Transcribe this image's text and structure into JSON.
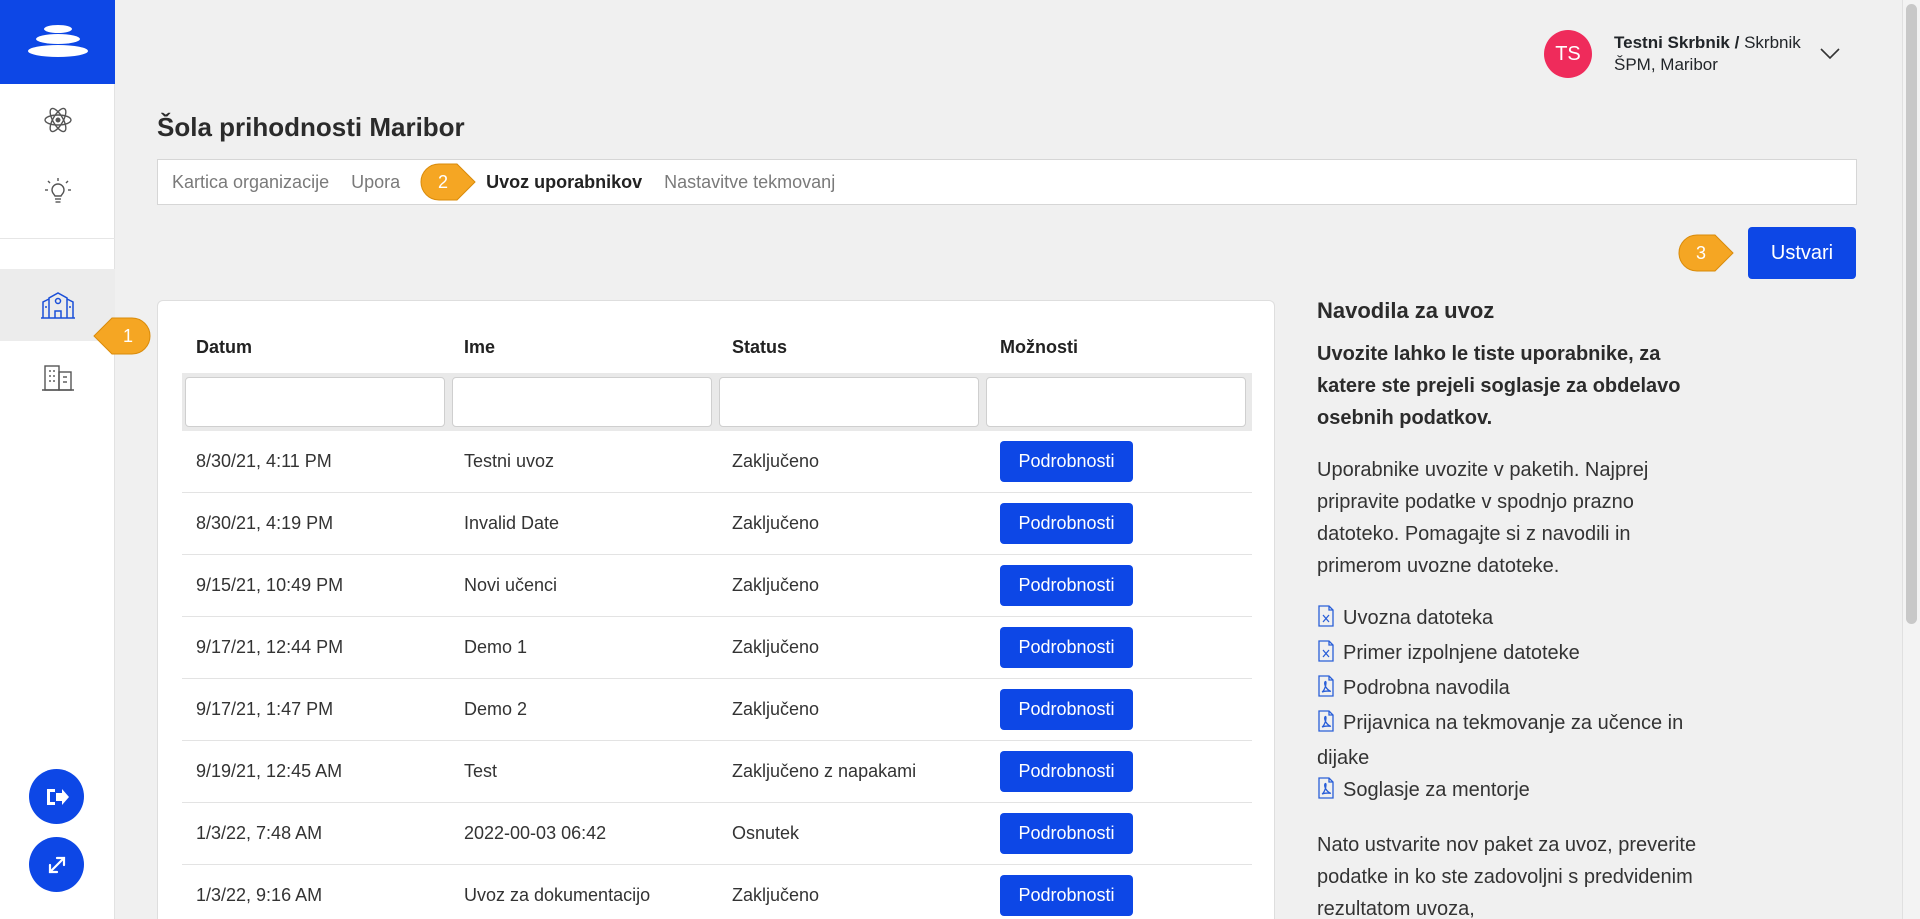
{
  "user": {
    "initials": "TS",
    "name": "Testni Skrbnik",
    "separator": " / ",
    "role": "Skrbnik",
    "org": "ŠPM, Maribor"
  },
  "page": {
    "title": "Šola prihodnosti Maribor"
  },
  "tabs": [
    {
      "label": "Kartica organizacije",
      "active": false
    },
    {
      "label": "Upora",
      "active": false
    },
    {
      "label": "Uvoz uporabnikov",
      "active": true
    },
    {
      "label": "Nastavitve tekmovanj",
      "active": false
    }
  ],
  "callouts": [
    "1",
    "2",
    "3"
  ],
  "actions": {
    "create_label": "Ustvari"
  },
  "table": {
    "headers": [
      "Datum",
      "Ime",
      "Status",
      "Možnosti"
    ],
    "button_label": "Podrobnosti",
    "rows": [
      {
        "date": "8/30/21, 4:11 PM",
        "name": "Testni uvoz",
        "status": "Zaključeno"
      },
      {
        "date": "8/30/21, 4:19 PM",
        "name": "Invalid Date",
        "status": "Zaključeno"
      },
      {
        "date": "9/15/21, 10:49 PM",
        "name": "Novi učenci",
        "status": "Zaključeno"
      },
      {
        "date": "9/17/21, 12:44 PM",
        "name": "Demo 1",
        "status": "Zaključeno"
      },
      {
        "date": "9/17/21, 1:47 PM",
        "name": "Demo 2",
        "status": "Zaključeno"
      },
      {
        "date": "9/19/21, 12:45 AM",
        "name": "Test",
        "status": "Zaključeno z napakami"
      },
      {
        "date": "1/3/22, 7:48 AM",
        "name": "2022-00-03 06:42",
        "status": "Osnutek"
      },
      {
        "date": "1/3/22, 9:16 AM",
        "name": "Uvoz za dokumentacijo",
        "status": "Zaključeno"
      }
    ]
  },
  "instructions": {
    "title": "Navodila za uvoz",
    "lead": "Uvozite lahko le tiste uporabnike, za katere ste prejeli soglasje za obdelavo osebnih podatkov.",
    "para1": "Uporabnike uvozite v paketih. Najprej pripravite podatke v spodnjo prazno datoteko. Pomagajte si z navodili in primerom uvozne datoteke.",
    "files": [
      {
        "label": "Uvozna datoteka",
        "icon": "excel-file-icon"
      },
      {
        "label": "Primer izpolnjene datoteke",
        "icon": "excel-file-icon"
      },
      {
        "label": "Podrobna navodila",
        "icon": "pdf-file-icon"
      },
      {
        "label": "Prijavnica na tekmovanje za učence in dijake",
        "icon": "pdf-file-icon"
      },
      {
        "label": "Soglasje za mentorje",
        "icon": "pdf-file-icon"
      }
    ],
    "para2": "Nato ustvarite nov paket za uvoz, preverite podatke in ko ste zadovoljni s predvidenim rezultatom uvoza,"
  },
  "colors": {
    "primary": "#0d47e6",
    "avatar": "#ef2b5b",
    "callout": "#f5a623"
  }
}
